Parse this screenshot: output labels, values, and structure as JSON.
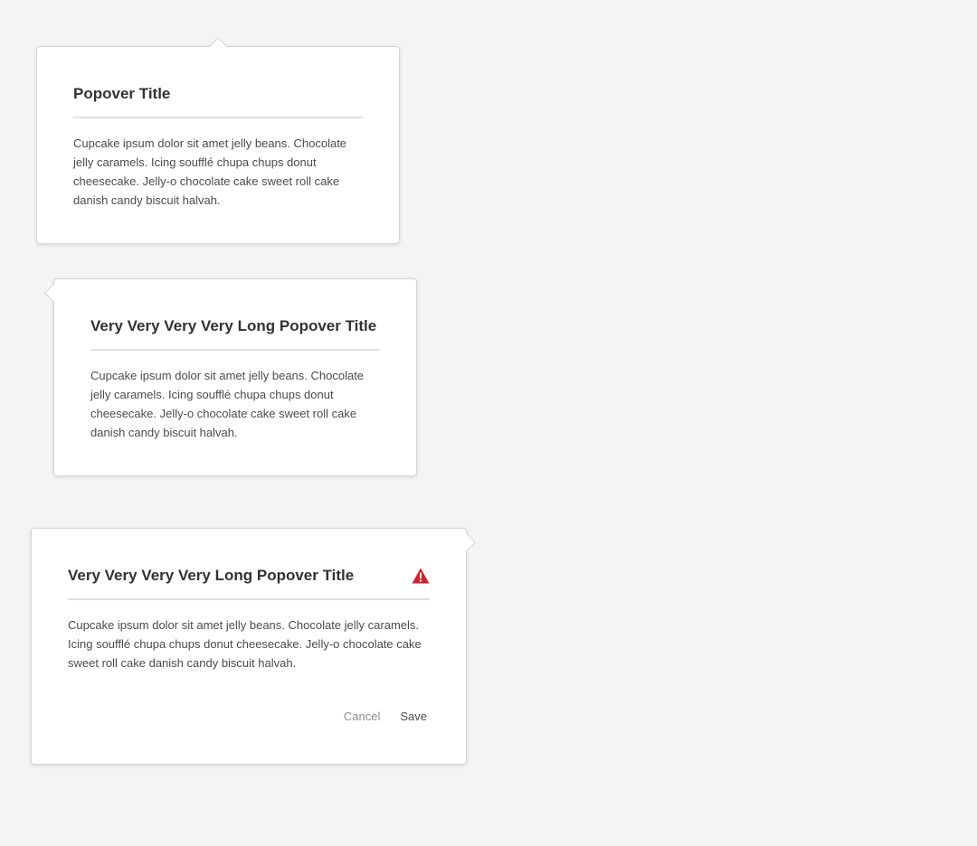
{
  "popovers": [
    {
      "title": "Popover Title",
      "body": "Cupcake ipsum dolor sit amet jelly beans. Chocolate jelly caramels. Icing soufflé chupa chups donut cheesecake. Jelly-o chocolate cake sweet roll cake danish candy biscuit halvah.",
      "tip": "top"
    },
    {
      "title": "Very Very Very Very Long Popover Title",
      "body": "Cupcake ipsum dolor sit amet jelly beans. Chocolate jelly caramels. Icing soufflé chupa chups donut cheesecake. Jelly-o chocolate cake sweet roll cake danish candy biscuit halvah.",
      "tip": "left"
    },
    {
      "title": "Very Very Very Very Long Popover Title",
      "body": "Cupcake ipsum dolor sit amet jelly beans. Chocolate jelly caramels. Icing soufflé chupa chups donut cheesecake. Jelly-o chocolate cake sweet roll cake danish candy biscuit halvah.",
      "tip": "right",
      "icon": "alert-icon",
      "buttons": {
        "cancel": "Cancel",
        "save": "Save"
      }
    }
  ],
  "colors": {
    "background": "#f4f4f4",
    "alert": "#c9252d",
    "divider": "#e1e1e1"
  }
}
